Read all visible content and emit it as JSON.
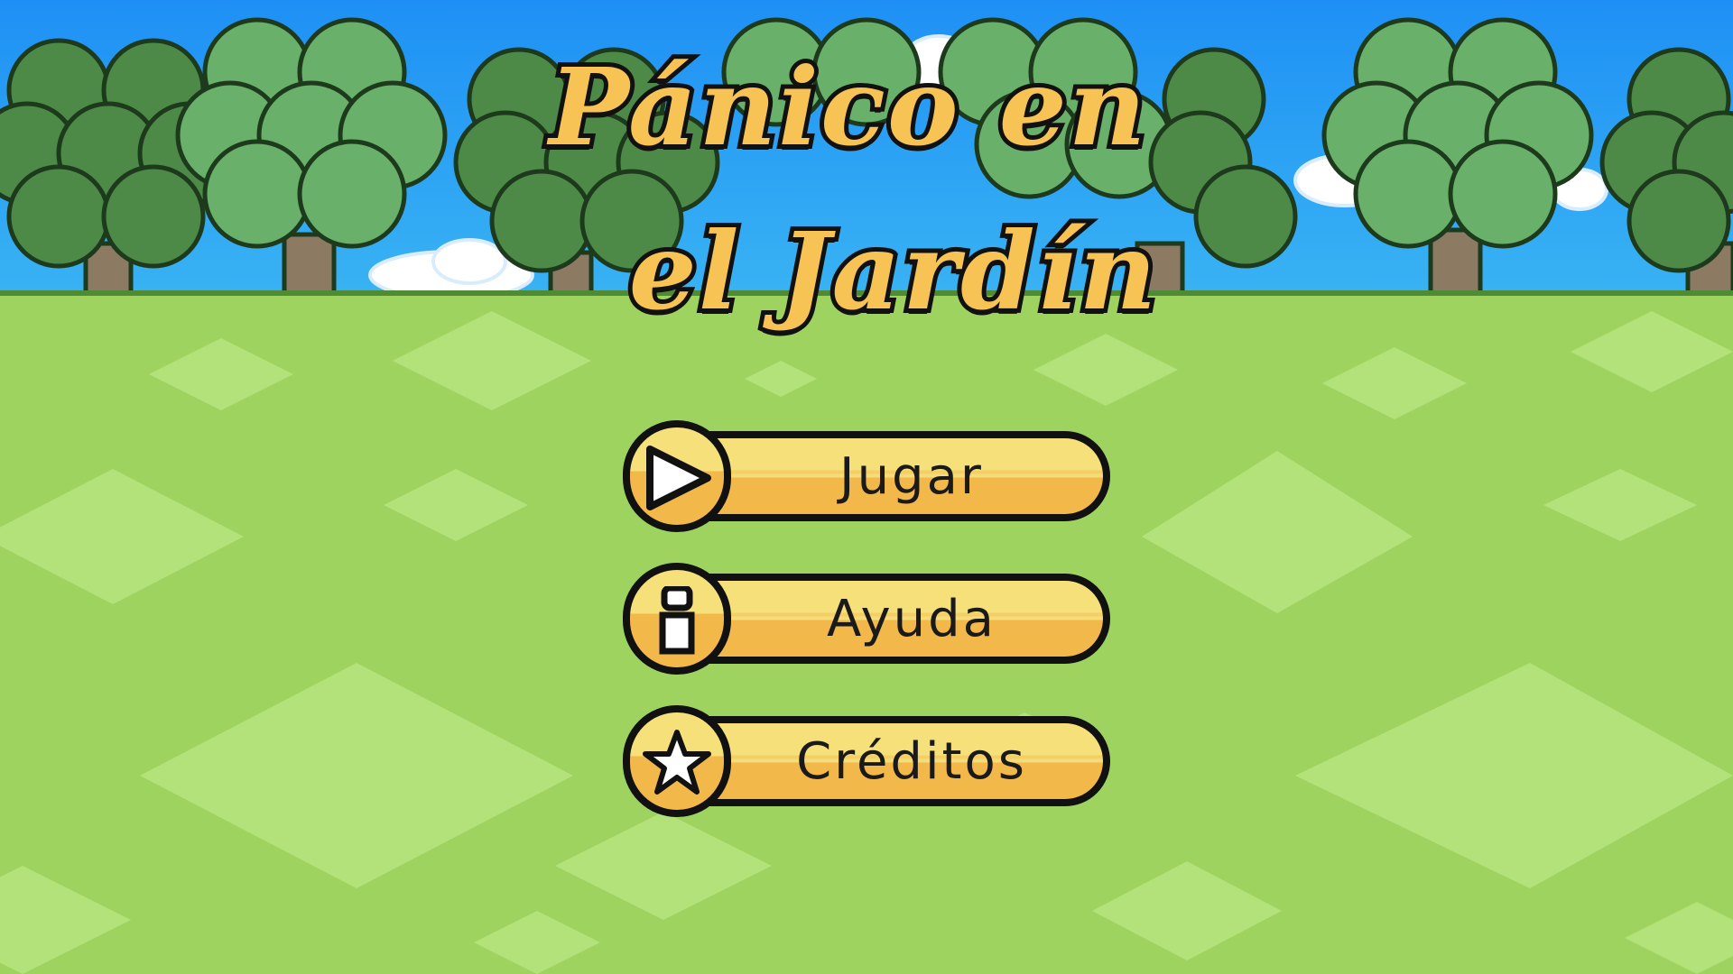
{
  "game": {
    "title_line1": "Pánico en",
    "title_line2": "el Jardín"
  },
  "menu": {
    "items": [
      {
        "label": "Jugar",
        "icon": "play-icon"
      },
      {
        "label": "Ayuda",
        "icon": "info-icon"
      },
      {
        "label": "Créditos",
        "icon": "star-icon"
      }
    ]
  },
  "colors": {
    "sky": "#2a9bf0",
    "grass": "#9ed35f",
    "grass_light": "#b4e27a",
    "tree_dark": "#4a8a47",
    "tree_light": "#69b06a",
    "trunk": "#8d7a63",
    "title_fill": "#f7c355",
    "button_light": "#f6e07a",
    "button_dark": "#f2b84a",
    "outline": "#111111"
  }
}
